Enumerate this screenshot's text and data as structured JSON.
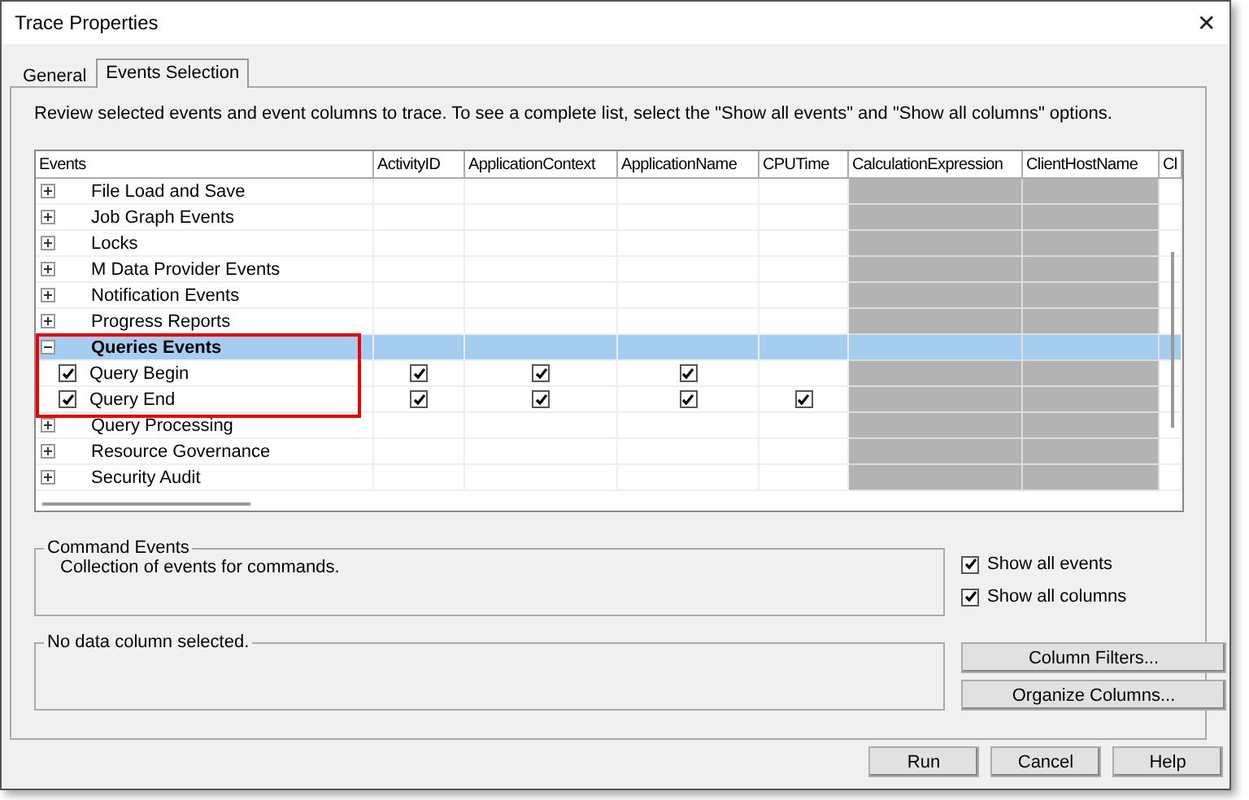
{
  "window": {
    "title": "Trace Properties",
    "close": "✕"
  },
  "tabs": [
    {
      "label": "General",
      "selected": false
    },
    {
      "label": "Events Selection",
      "selected": true
    }
  ],
  "instructions": "Review selected events and event columns to trace. To see a complete list, select the \"Show all events\" and \"Show all columns\" options.",
  "grid": {
    "columns": [
      {
        "label": "Events"
      },
      {
        "label": "ActivityID",
        "disabled": false
      },
      {
        "label": "ApplicationContext",
        "disabled": false
      },
      {
        "label": "ApplicationName",
        "disabled": false
      },
      {
        "label": "CPUTime",
        "disabled": false
      },
      {
        "label": "CalculationExpression",
        "disabled": true
      },
      {
        "label": "ClientHostName",
        "disabled": true
      },
      {
        "label": "Cl",
        "disabled": false
      }
    ],
    "categories": [
      {
        "label": "File Load and Save",
        "expanded": false,
        "selected": false,
        "highlighted": false
      },
      {
        "label": "Job Graph Events",
        "expanded": false,
        "selected": false,
        "highlighted": false
      },
      {
        "label": "Locks",
        "expanded": false,
        "selected": false,
        "highlighted": false
      },
      {
        "label": "M Data Provider Events",
        "expanded": false,
        "selected": false,
        "highlighted": false
      },
      {
        "label": "Notification Events",
        "expanded": false,
        "selected": false,
        "highlighted": false
      },
      {
        "label": "Progress Reports",
        "expanded": false,
        "selected": false,
        "highlighted": false
      },
      {
        "label": "Queries Events",
        "expanded": true,
        "selected": true,
        "highlighted": true,
        "children": [
          {
            "label": "Query Begin",
            "checked": true,
            "cells": [
              true,
              true,
              true,
              false,
              false,
              false,
              false
            ]
          },
          {
            "label": "Query End",
            "checked": true,
            "cells": [
              true,
              true,
              true,
              true,
              false,
              false,
              false
            ]
          }
        ]
      },
      {
        "label": "Query Processing",
        "expanded": false,
        "selected": false,
        "highlighted": false
      },
      {
        "label": "Resource Governance",
        "expanded": false,
        "selected": false,
        "highlighted": false
      },
      {
        "label": "Security Audit",
        "expanded": false,
        "selected": false,
        "highlighted": false
      }
    ]
  },
  "event_info": {
    "legend": "Command Events",
    "description": "Collection of events for commands."
  },
  "column_info": {
    "legend": "No data column selected."
  },
  "options": [
    {
      "label": "Show all events",
      "checked": true
    },
    {
      "label": "Show all columns",
      "checked": true
    }
  ],
  "side_buttons": [
    "Column Filters...",
    "Organize Columns..."
  ],
  "footer_buttons": [
    "Run",
    "Cancel",
    "Help"
  ]
}
